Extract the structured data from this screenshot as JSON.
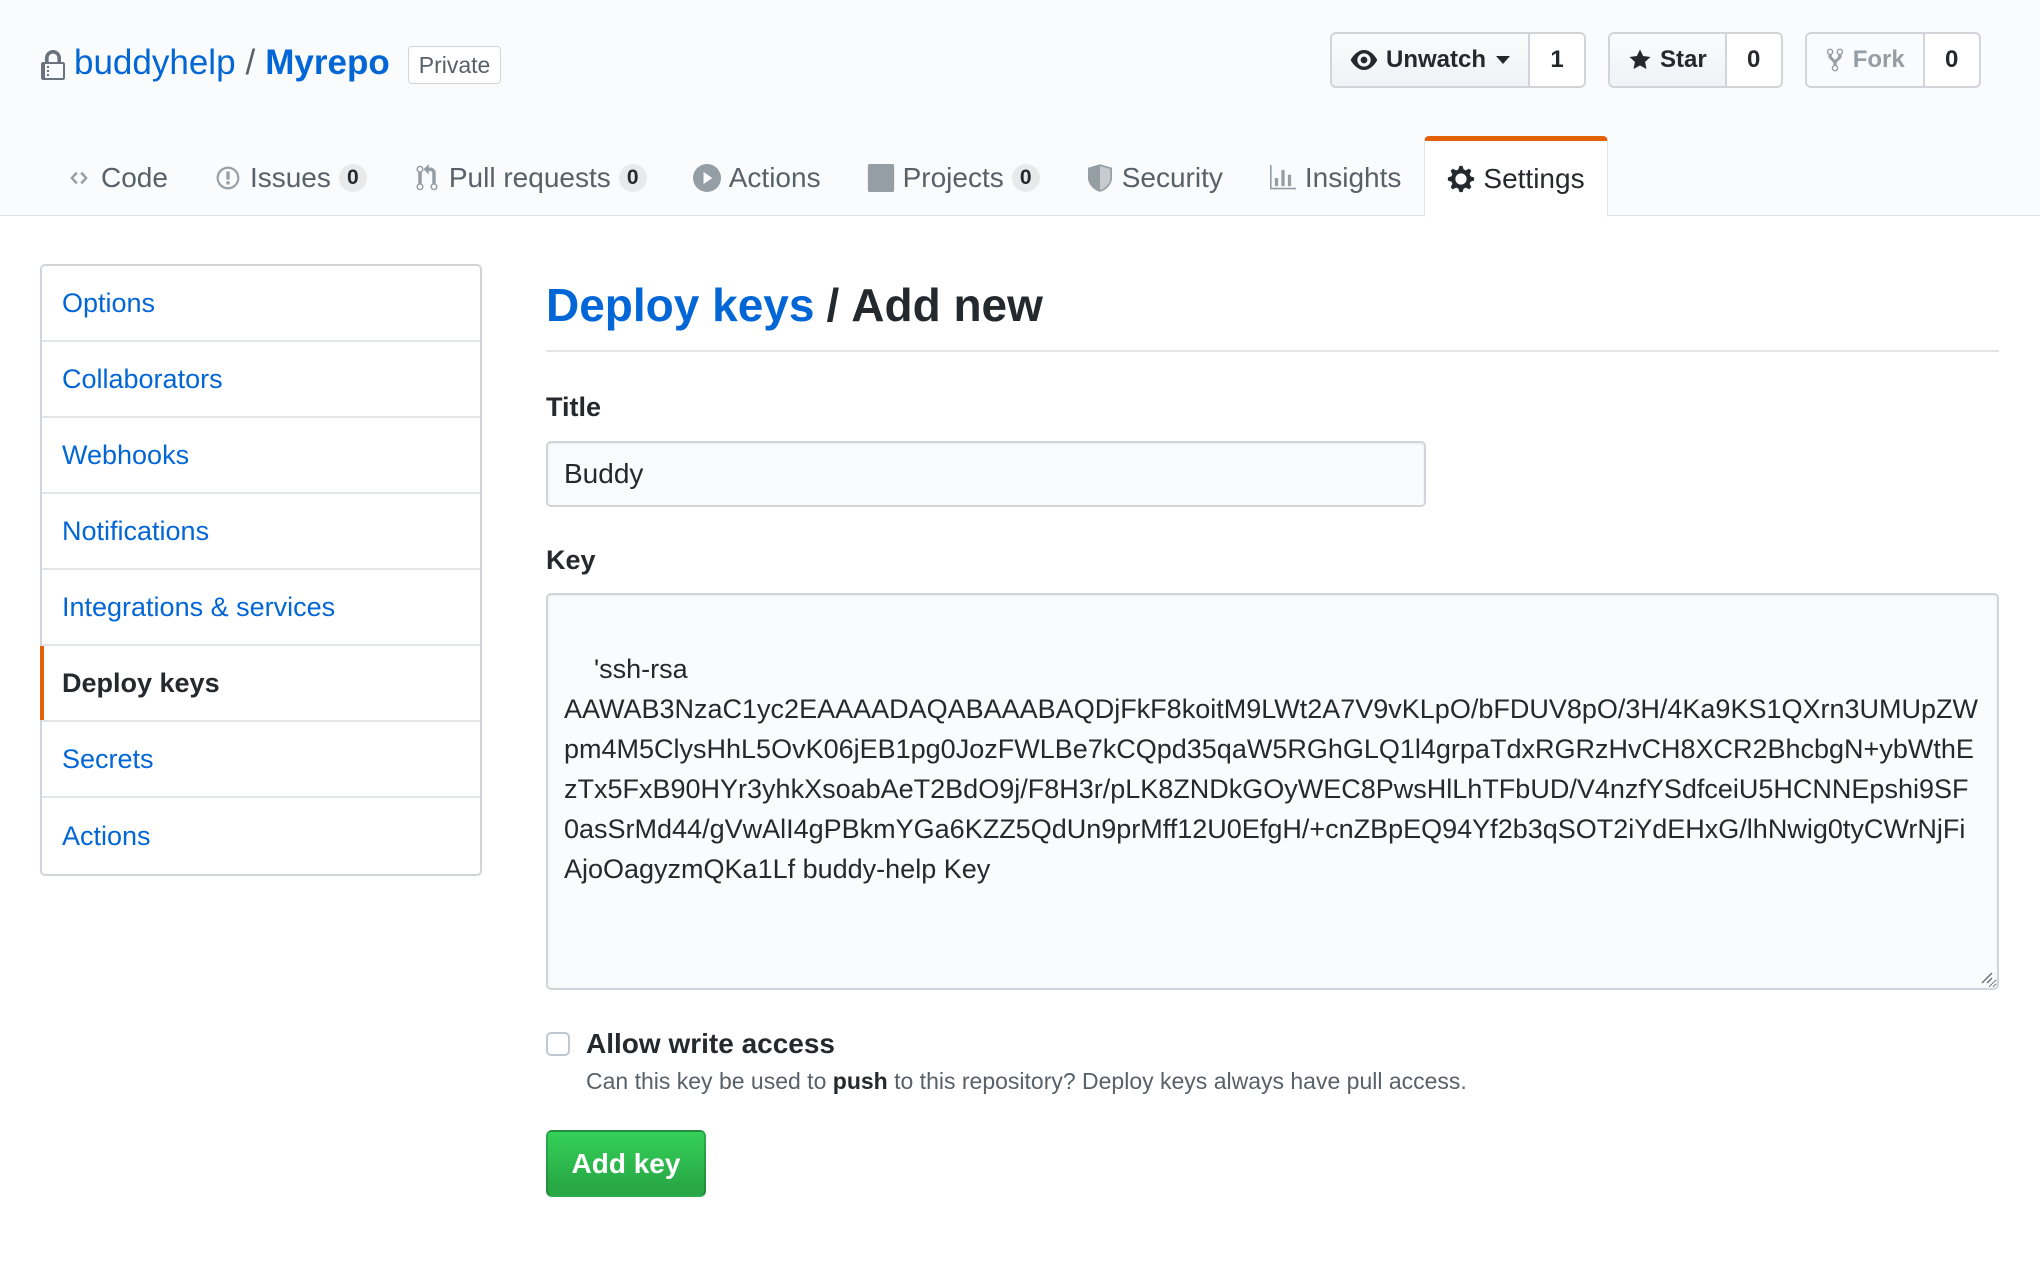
{
  "repo": {
    "owner": "buddyhelp",
    "separator": "/",
    "name": "Myrepo",
    "visibility": "Private"
  },
  "actions": {
    "watch": {
      "label": "Unwatch",
      "count": "1"
    },
    "star": {
      "label": "Star",
      "count": "0"
    },
    "fork": {
      "label": "Fork",
      "count": "0"
    }
  },
  "tabs": [
    {
      "label": "Code",
      "icon": "code-icon"
    },
    {
      "label": "Issues",
      "icon": "issue-opened-icon",
      "count": "0"
    },
    {
      "label": "Pull requests",
      "icon": "git-pull-request-icon",
      "count": "0"
    },
    {
      "label": "Actions",
      "icon": "play-icon"
    },
    {
      "label": "Projects",
      "icon": "project-icon",
      "count": "0"
    },
    {
      "label": "Security",
      "icon": "shield-icon"
    },
    {
      "label": "Insights",
      "icon": "graph-icon"
    },
    {
      "label": "Settings",
      "icon": "gear-icon",
      "selected": true
    }
  ],
  "sidebar": {
    "items": [
      {
        "label": "Options"
      },
      {
        "label": "Collaborators"
      },
      {
        "label": "Webhooks"
      },
      {
        "label": "Notifications"
      },
      {
        "label": "Integrations & services"
      },
      {
        "label": "Deploy keys",
        "selected": true
      },
      {
        "label": "Secrets"
      },
      {
        "label": "Actions"
      }
    ]
  },
  "main": {
    "breadcrumb_link": "Deploy keys",
    "breadcrumb_sep": "/",
    "heading": "Add new",
    "title_label": "Title",
    "title_value": "Buddy",
    "key_label": "Key",
    "key_value": "'ssh-rsa\nAAWAB3NzaC1yc2EAAAADAQABAAABAQDjFkF8koitM9LWt2A7V9vKLpO/bFDUV8pO/3H/4Ka9KS1QXrn3UMUpZWpm4M5ClysHhL5OvK06jEB1pg0JozFWLBe7kCQpd35qaW5RGhGLQ1l4grpaTdxRGRzHvCH8XCR2BhcbgN+ybWthEzTx5FxB90HYr3yhkXsoabAeT2BdO9j/F8H3r/pLK8ZNDkGOyWEC8PwsHlLhTFbUD/V4nzfYSdfceiU5HCNNEpshi9SF0asSrMd44/gVwAlI4gPBkmYGa6KZZ5QdUn9prMff12U0EfgH/+cnZBpEQ94Yf2b3qSOT2iYdEHxG/lhNwig0tyCWrNjFiAjoOagyzmQKa1Lf buddy-help Key",
    "write_access_label": "Allow write access",
    "write_access_checked": false,
    "note_before": "Can this key be used to ",
    "note_bold": "push",
    "note_after": " to this repository? Deploy keys always have pull access.",
    "submit_label": "Add key"
  },
  "colors": {
    "link": "#0366d6",
    "accent_orange": "#e36209",
    "primary_green": "#28a745",
    "header_bg": "#fafbfc"
  }
}
